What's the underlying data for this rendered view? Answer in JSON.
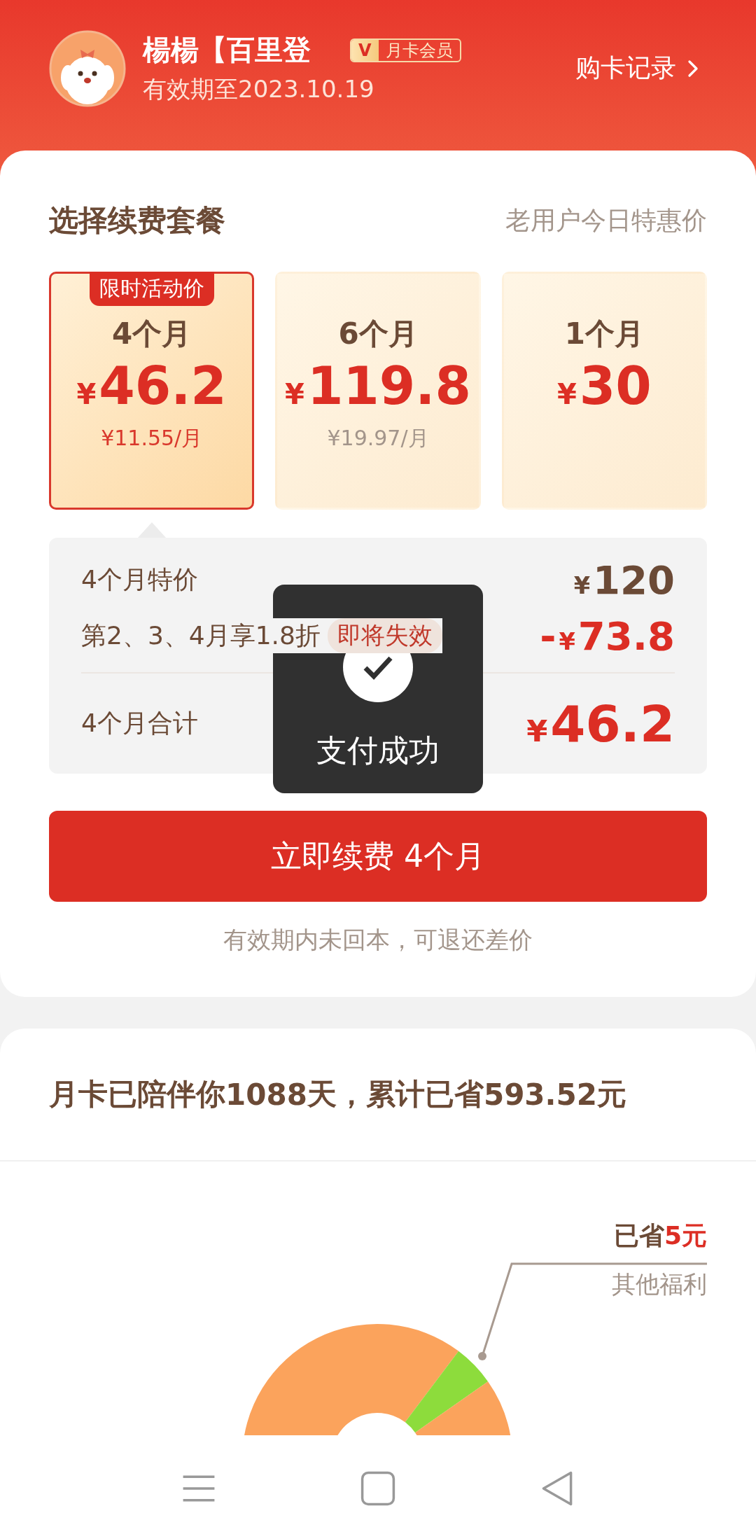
{
  "header": {
    "name": "楊楊【百里登",
    "badge": {
      "mark": "V",
      "label": "月卡会员"
    },
    "expiry": "有效期至2023.10.19",
    "records_link": "购卡记录"
  },
  "plans_card": {
    "title": "选择续费套餐",
    "subtitle": "老用户今日特惠价",
    "plans": [
      {
        "tag": "限时活动价",
        "duration": "4个月",
        "currency": "¥",
        "price": "46.2",
        "per_month": "¥11.55/月",
        "selected": true
      },
      {
        "duration": "6个月",
        "currency": "¥",
        "price": "119.8",
        "per_month": "¥19.97/月",
        "selected": false
      },
      {
        "duration": "1个月",
        "currency": "¥",
        "price": "30",
        "selected": false
      }
    ],
    "breakdown": [
      {
        "kind": "base",
        "label": "4个月特价",
        "currency": "¥",
        "amount": "120"
      },
      {
        "kind": "discount",
        "label": "第2、3、4月享1.8折",
        "tag": "即将失效",
        "sign": "-",
        "currency": "¥",
        "amount": "73.8"
      },
      {
        "kind": "total",
        "label": "4个月合计",
        "currency": "¥",
        "amount": "46.2"
      }
    ],
    "button": "立即续费 4个月",
    "note": "有效期内未回本，可退还差价"
  },
  "toast": {
    "text": "支付成功"
  },
  "stats_card": {
    "summary": "月卡已陪伴你**1088**天，累计已省**593.52**元",
    "callout": {
      "label": "已省",
      "amount": "5元",
      "caption": "其他福利"
    }
  }
}
